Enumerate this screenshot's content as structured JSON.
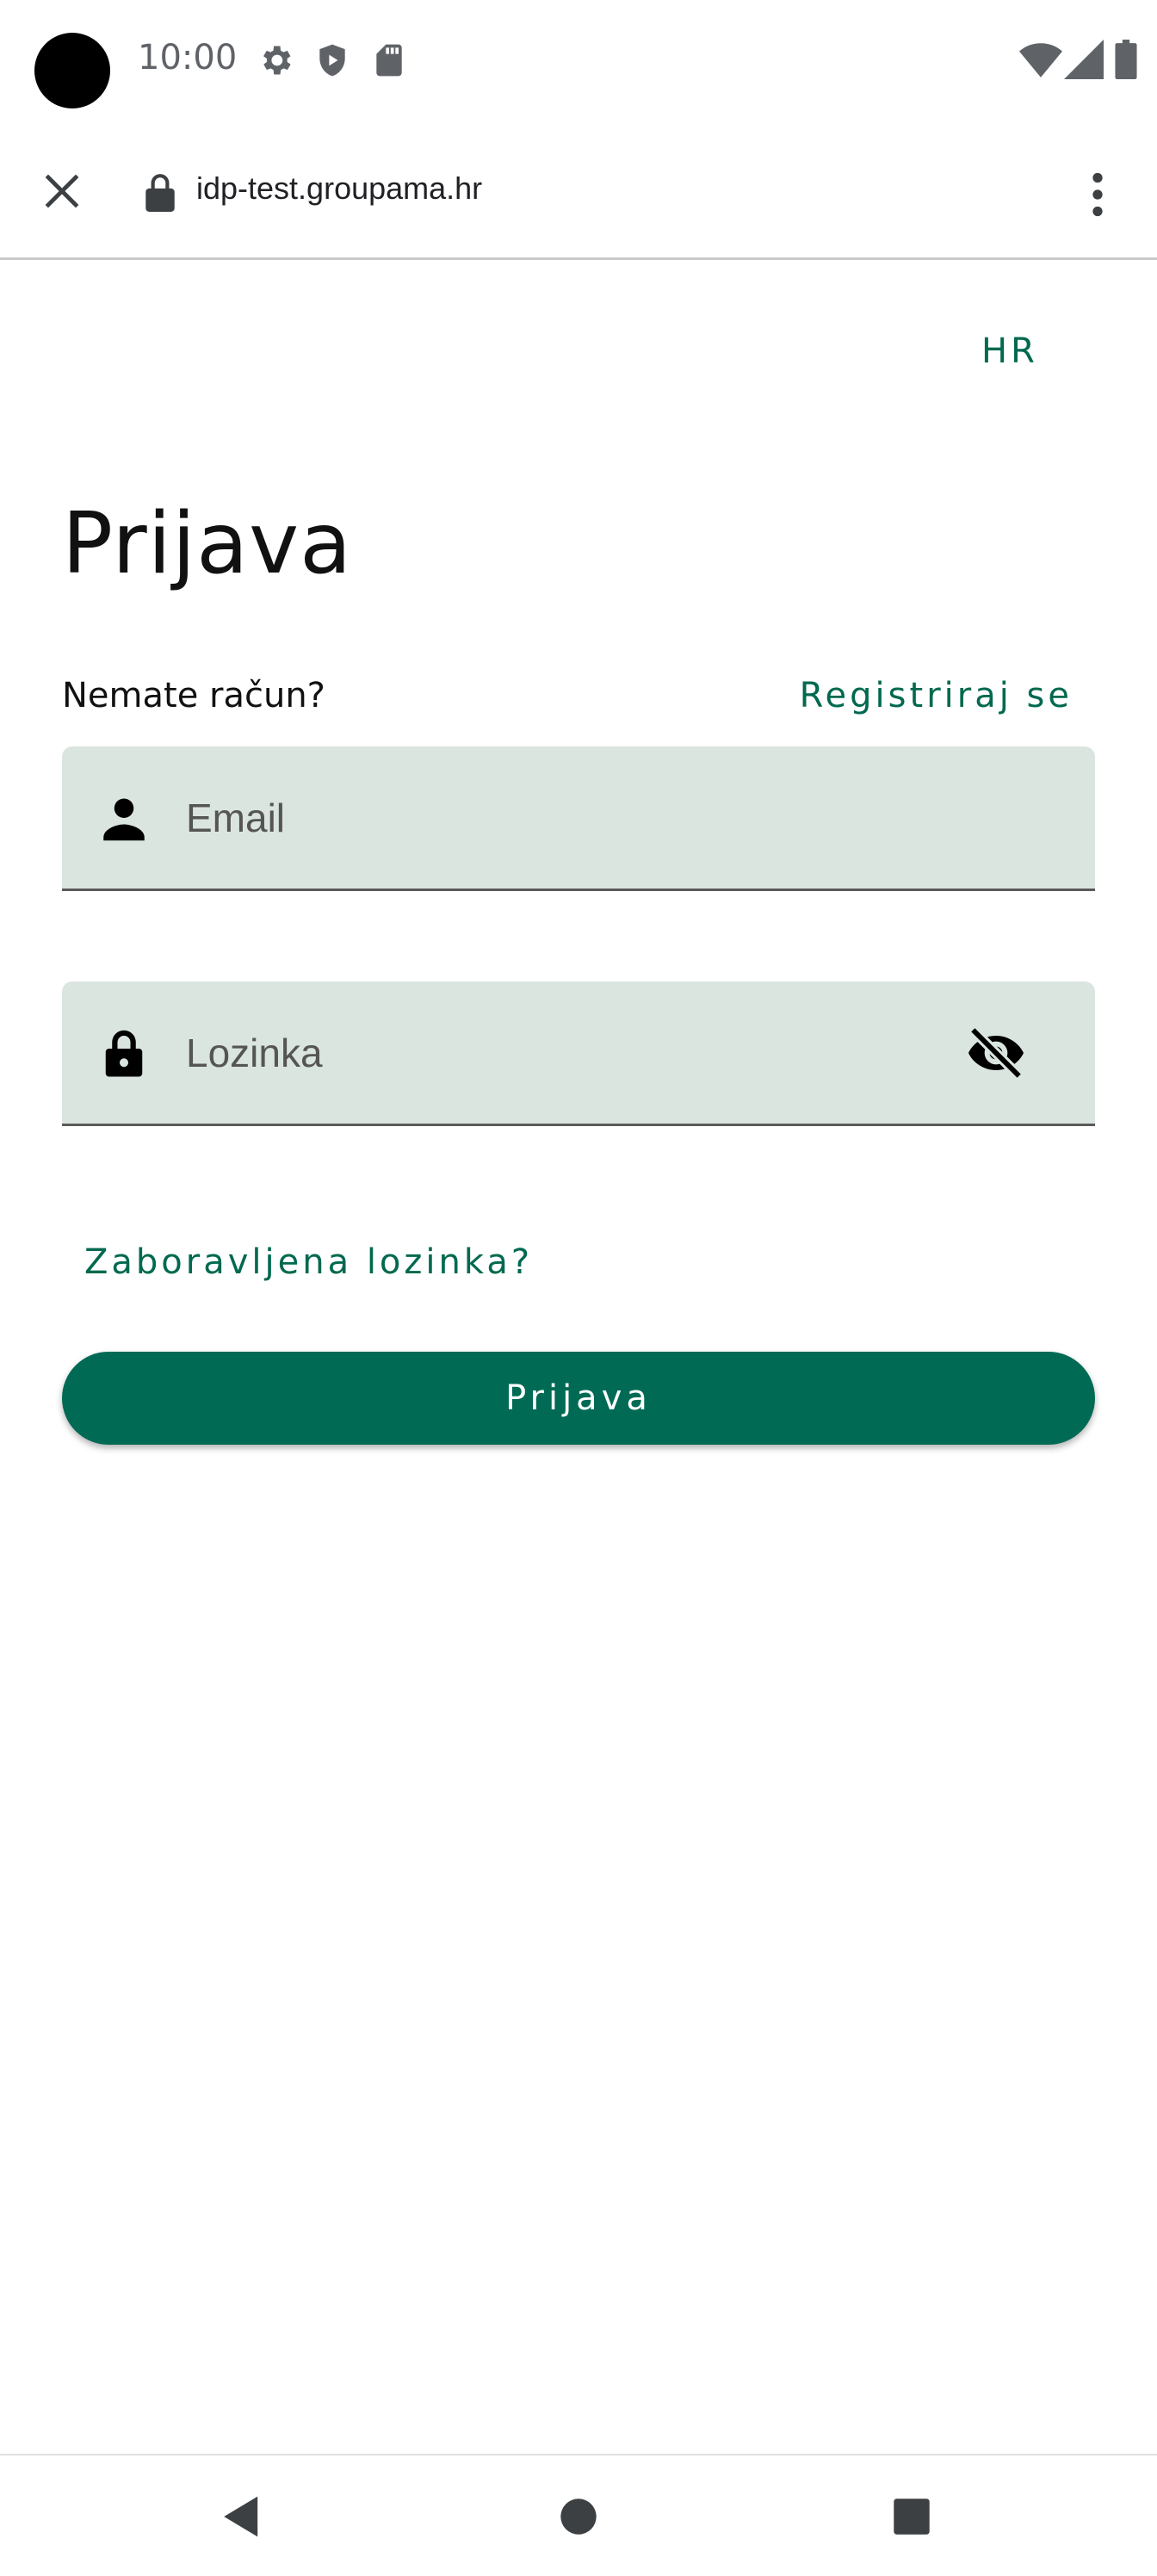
{
  "status_bar": {
    "time": "10:00",
    "icons": [
      "gear-icon",
      "shield-icon",
      "sd-card-icon",
      "wifi-icon",
      "signal-icon",
      "battery-icon"
    ]
  },
  "browser": {
    "url": "idp-test.groupama.hr",
    "icons": [
      "close-icon",
      "lock-icon",
      "more-vert-icon"
    ]
  },
  "page": {
    "language": "HR",
    "title": "Prijava",
    "no_account_text": "Nemate račun?",
    "register_label": "Registriraj se",
    "email_placeholder": "Email",
    "password_placeholder": "Lozinka",
    "forgot_password_label": "Zaboravljena lozinka?",
    "login_button_label": "Prijava"
  },
  "nav_bar": {
    "icons": [
      "back-icon",
      "home-icon",
      "recents-icon"
    ]
  },
  "colors": {
    "brand_green": "#006a54",
    "link_green": "#00694f",
    "field_background": "#dbe5df"
  }
}
